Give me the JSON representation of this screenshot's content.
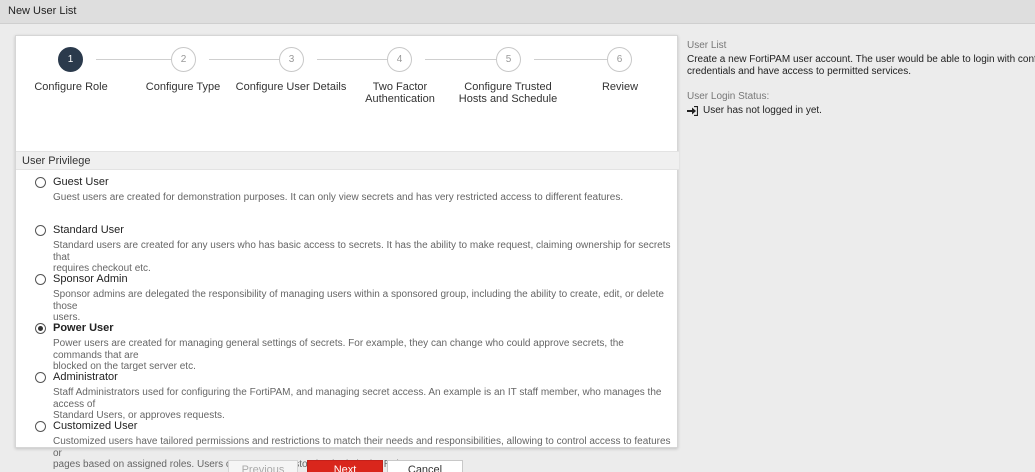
{
  "window": {
    "title": "New User List"
  },
  "steps": [
    {
      "number": "1",
      "label_line1": "Configure Role",
      "label_line2": "",
      "active": true
    },
    {
      "number": "2",
      "label_line1": "Configure Type",
      "label_line2": "",
      "active": false
    },
    {
      "number": "3",
      "label_line1": "Configure User Details",
      "label_line2": "",
      "active": false
    },
    {
      "number": "4",
      "label_line1": "Two Factor",
      "label_line2": "Authentication",
      "active": false
    },
    {
      "number": "5",
      "label_line1": "Configure Trusted",
      "label_line2": "Hosts and Schedule",
      "active": false
    },
    {
      "number": "6",
      "label_line1": "Review",
      "label_line2": "",
      "active": false
    }
  ],
  "section": {
    "title": "User Privilege"
  },
  "privilege_options": [
    {
      "title": "Guest User",
      "selected": false,
      "desc_line1": "Guest users are created for demonstration purposes. It can only view secrets and has very restricted access to different features.",
      "desc_line2": ""
    },
    {
      "title": "Standard User",
      "selected": false,
      "desc_line1": "Standard users are created for any users who has basic access to secrets. It has the ability to make request, claiming ownership for secrets that",
      "desc_line2": "requires checkout etc."
    },
    {
      "title": "Sponsor Admin",
      "selected": false,
      "desc_line1": "Sponsor admins are delegated the responsibility of managing users within a sponsored group, including the ability to create, edit, or delete those",
      "desc_line2": "users."
    },
    {
      "title": "Power User",
      "selected": true,
      "desc_line1": "Power users are created for managing general settings of secrets. For example, they can change who could approve secrets, the commands that are",
      "desc_line2": "blocked on the target server etc."
    },
    {
      "title": "Administrator",
      "selected": false,
      "desc_line1": "Staff Administrators used for configuring the FortiPAM, and managing secret access. An example is an IT staff member, who manages the access of",
      "desc_line2": "Standard Users, or approves requests."
    },
    {
      "title": "Customized User",
      "selected": false,
      "desc_line1": "Customized users have tailored permissions and restrictions to match their needs and responsibilities, allowing to control access to features or",
      "desc_line2": "pages based on assigned roles. Users can create a customized role in the Role page."
    }
  ],
  "buttons": {
    "previous": "Previous",
    "next": "Next",
    "cancel": "Cancel"
  },
  "sidebar": {
    "section_label": "User List",
    "description_line1": "Create a new FortiPAM user account. The user would be able to login with configured",
    "description_line2": "credentials and have access to permitted services.",
    "status_label": "User Login Status:",
    "status_text": "User has not logged in yet."
  },
  "colors": {
    "active_step": "#2b3a4c",
    "primary_button": "#d9261c"
  }
}
